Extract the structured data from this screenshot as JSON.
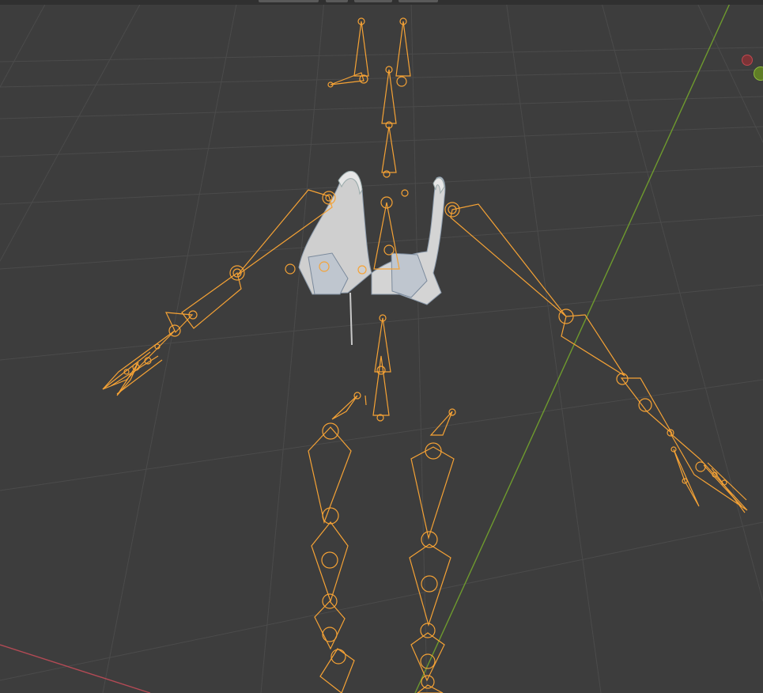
{
  "app": {
    "view": "3D Viewport",
    "mode": "Pose"
  },
  "colors": {
    "background": "#3d3d3d",
    "grid_line": "#4a4a4a",
    "axis_x": "#b34a55",
    "axis_y": "#6e9a2e",
    "bone_selected": "#f5a235",
    "mesh": "#d8d8d8",
    "mesh_edge": "#9aa8b8"
  },
  "gizmo": {
    "x_axis_icon": "gizmo-x-axis-icon",
    "y_axis_icon": "gizmo-y-axis-icon"
  },
  "objects": {
    "armature": "armature-rig",
    "mesh": "bra-mesh"
  }
}
